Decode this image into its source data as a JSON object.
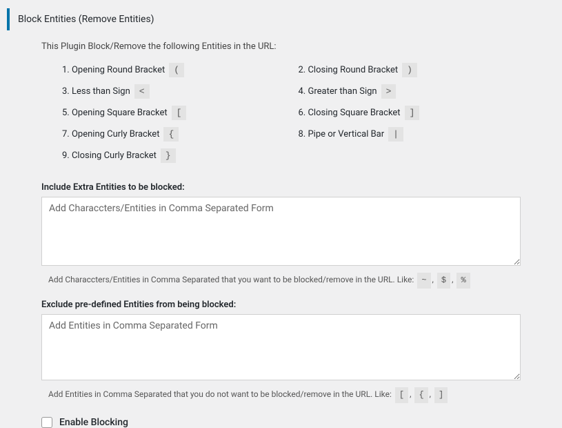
{
  "heading": "Block Entities (Remove Entities)",
  "intro": "This Plugin Block/Remove the following Entities in the URL:",
  "entities": [
    {
      "num": "1.",
      "label": "Opening Round Bracket",
      "char": "("
    },
    {
      "num": "2.",
      "label": "Closing Round Bracket",
      "char": ")"
    },
    {
      "num": "3.",
      "label": "Less than Sign",
      "char": "<"
    },
    {
      "num": "4.",
      "label": "Greater than Sign",
      "char": ">"
    },
    {
      "num": "5.",
      "label": "Opening Square Bracket",
      "char": "["
    },
    {
      "num": "6.",
      "label": "Closing Square Bracket",
      "char": "]"
    },
    {
      "num": "7.",
      "label": "Opening Curly Bracket",
      "char": "{"
    },
    {
      "num": "8.",
      "label": "Pipe or Vertical Bar",
      "char": "|"
    },
    {
      "num": "9.",
      "label": "Closing Curly Bracket",
      "char": "}"
    }
  ],
  "include": {
    "label": "Include Extra Entities to be blocked:",
    "placeholder": "Add Characcters/Entities in Comma Separated Form",
    "helper_prefix": "Add Characcters/Entities in Comma Separated that you want to be blocked/remove in the URL. Like:",
    "helper_chars": [
      "~",
      "$",
      "%"
    ]
  },
  "exclude": {
    "label": "Exclude pre-defined Entities from being blocked:",
    "placeholder": "Add Entities in Comma Separated Form",
    "helper_prefix": "Add Entities in Comma Separated that you do not want to be blocked/remove in the URL. Like:",
    "helper_chars": [
      "[",
      "{",
      "]"
    ]
  },
  "enable": {
    "label": "Enable Blocking"
  },
  "sep": ","
}
